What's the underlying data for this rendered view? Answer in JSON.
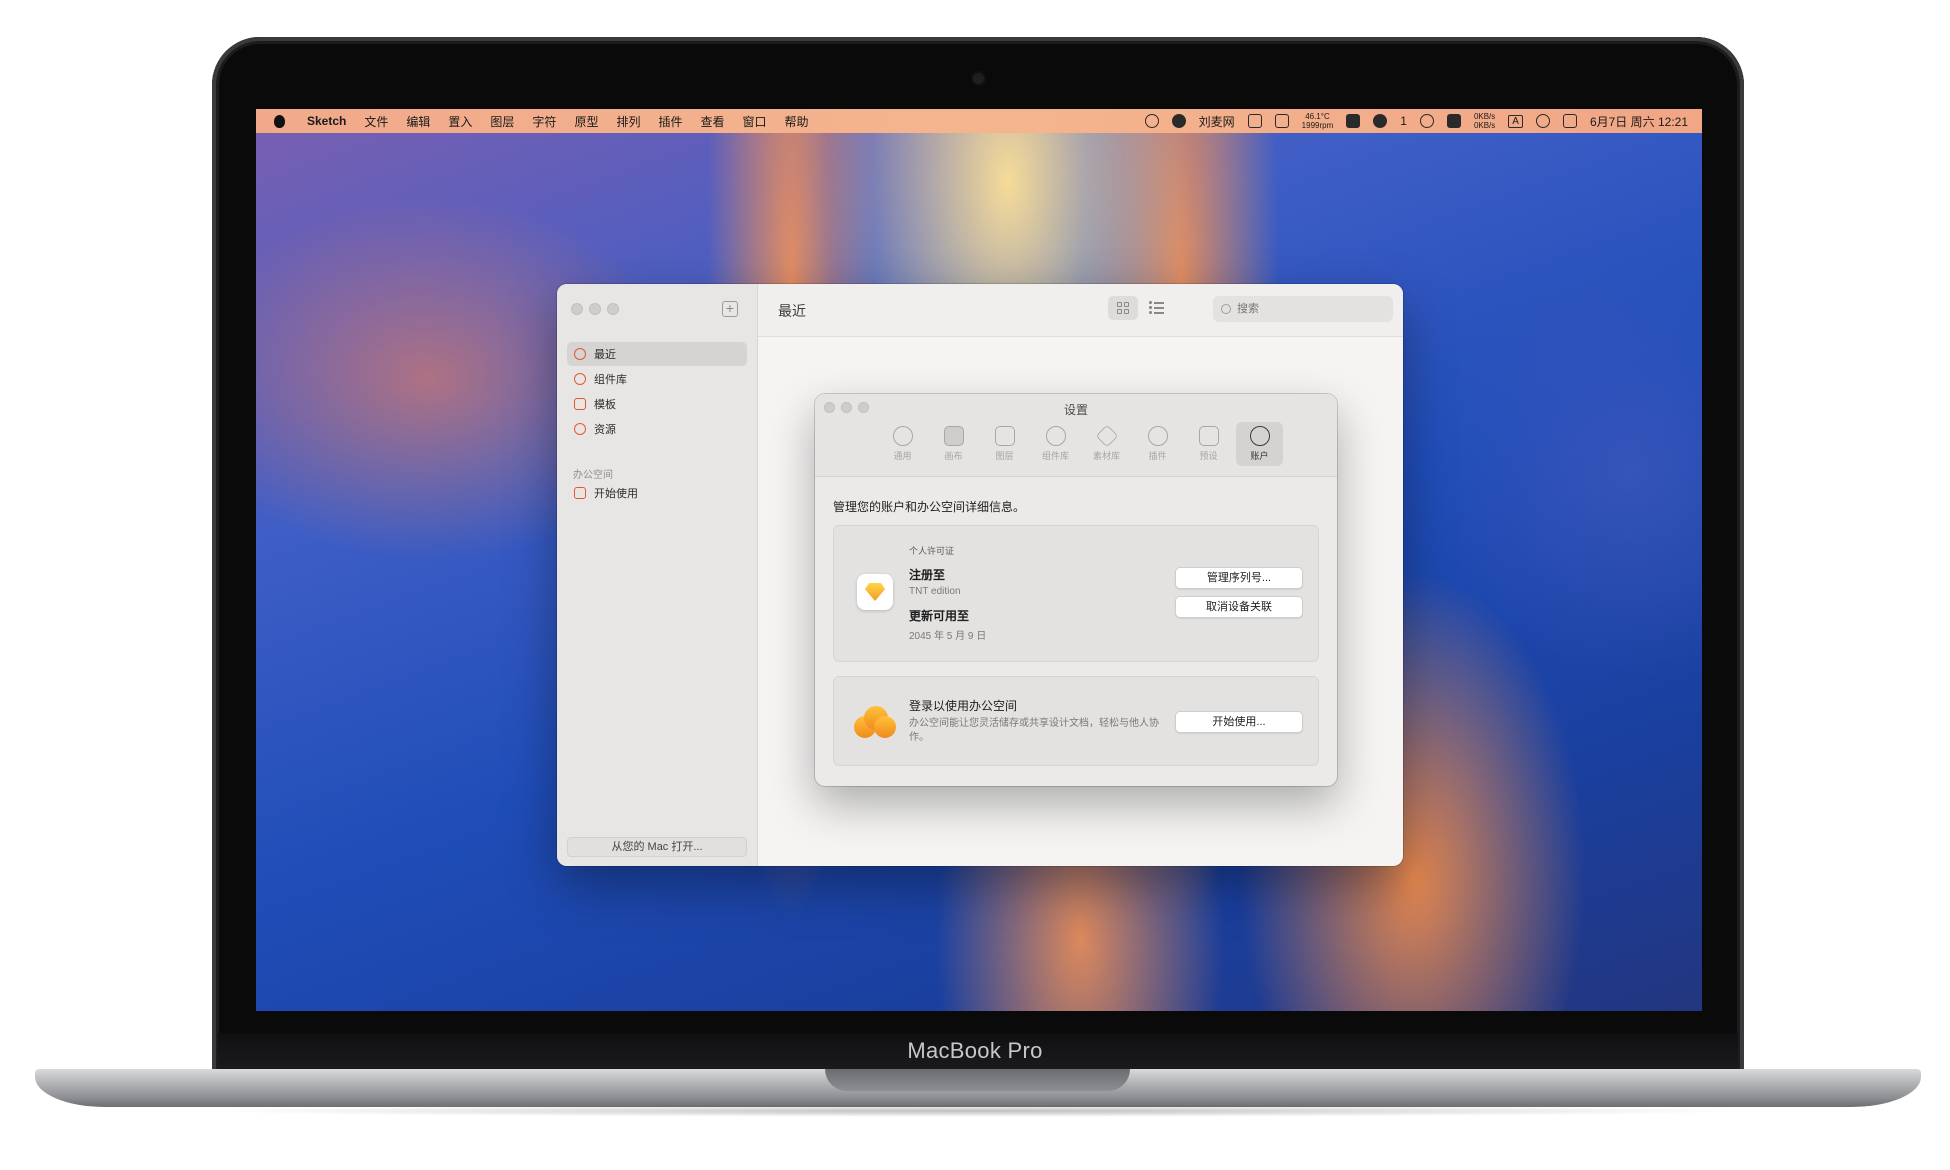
{
  "device": {
    "model": "MacBook Pro"
  },
  "menubar": {
    "app": "Sketch",
    "menus": [
      "文件",
      "编辑",
      "置入",
      "图层",
      "字符",
      "原型",
      "排列",
      "插件",
      "查看",
      "窗口",
      "帮助"
    ],
    "user": "刘麦网",
    "temp": "46.1°C",
    "rpm": "1999rpm",
    "wechat_count": "1",
    "net_up": "0KB/s",
    "net_down": "0KB/s",
    "input": "A",
    "datetime": "6月7日 周六 12:21"
  },
  "main_window": {
    "title": "最近",
    "search_placeholder": "搜索",
    "sidebar": {
      "items": [
        {
          "label": "最近",
          "icon": "clock-icon",
          "active": true
        },
        {
          "label": "组件库",
          "icon": "link-icon"
        },
        {
          "label": "模板",
          "icon": "grid-icon"
        },
        {
          "label": "资源",
          "icon": "palette-icon"
        }
      ],
      "section": "办公空间",
      "section_items": [
        {
          "label": "开始使用",
          "icon": "enter-icon"
        }
      ],
      "open_button": "从您的 Mac 打开..."
    }
  },
  "settings": {
    "title": "设置",
    "tabs": [
      {
        "label": "通用",
        "icon": "gear-icon"
      },
      {
        "label": "画布",
        "icon": "canvas-icon"
      },
      {
        "label": "图层",
        "icon": "layers-copy-icon"
      },
      {
        "label": "组件库",
        "icon": "link-icon"
      },
      {
        "label": "素材库",
        "icon": "stack-icon"
      },
      {
        "label": "插件",
        "icon": "plugin-icon"
      },
      {
        "label": "预设",
        "icon": "sliders-icon"
      },
      {
        "label": "账户",
        "icon": "account-icon",
        "active": true
      }
    ],
    "description": "管理您的账户和办公空间详细信息。",
    "license": {
      "caption": "个人许可证",
      "registered_label": "注册至",
      "registered_value": "TNT edition",
      "update_label": "更新可用至",
      "update_value": "2045 年 5 月 9 日",
      "button_manage": "管理序列号...",
      "button_unlink": "取消设备关联"
    },
    "workspace": {
      "title": "登录以使用办公空间",
      "description": "办公空间能让您灵活储存或共享设计文档，轻松与他人协作。",
      "button_start": "开始使用..."
    }
  }
}
